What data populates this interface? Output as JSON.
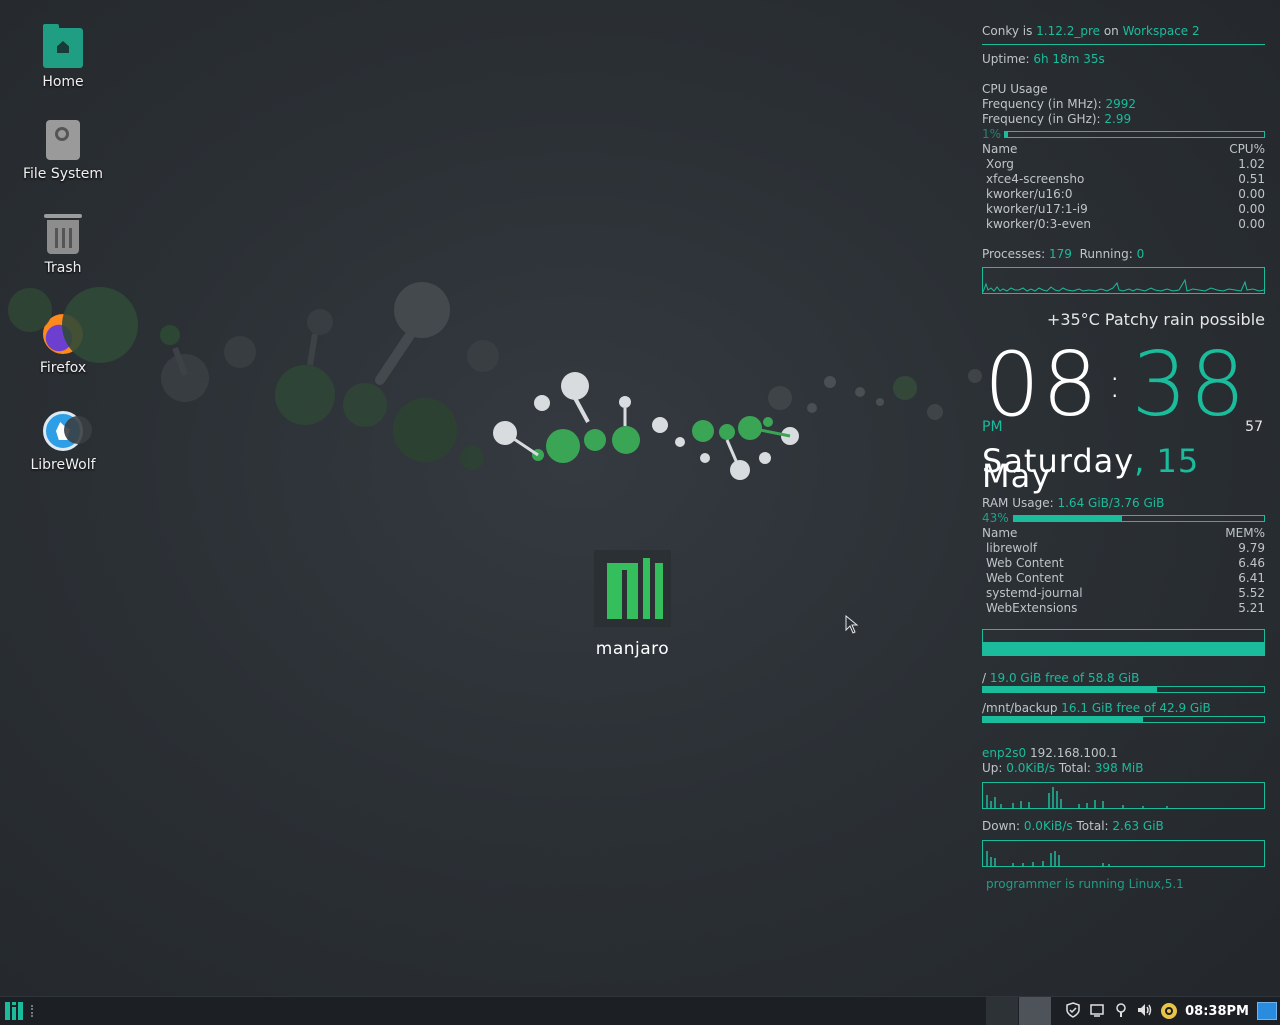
{
  "desktop": {
    "icons": [
      {
        "label": "Home",
        "icon": "home-folder-icon"
      },
      {
        "label": "File System",
        "icon": "drive-icon"
      },
      {
        "label": "Trash",
        "icon": "trash-icon"
      },
      {
        "label": "Firefox",
        "icon": "firefox-icon"
      },
      {
        "label": "LibreWolf",
        "icon": "librewolf-icon"
      }
    ],
    "wallpaper_logo_text": "manjaro"
  },
  "conky": {
    "header": {
      "prefix": "Conky is ",
      "version": "1.12.2_pre",
      "on": " on ",
      "workspace": "Workspace 2"
    },
    "uptime": {
      "label": "Uptime: ",
      "value": "6h 18m 35s"
    },
    "cpu": {
      "title": "CPU Usage",
      "freq_mhz_label": "Frequency (in MHz): ",
      "freq_mhz": "2992",
      "freq_ghz_label": "Frequency (in GHz): ",
      "freq_ghz": "2.99",
      "usage_text": "1%",
      "usage_fraction": 0.01,
      "col_name": "Name",
      "col_value": "CPU%",
      "processes": [
        {
          "name": "Xorg",
          "value": "1.02"
        },
        {
          "name": "xfce4-screensho",
          "value": "0.51"
        },
        {
          "name": "kworker/u16:0",
          "value": "0.00"
        },
        {
          "name": "kworker/u17:1-i9",
          "value": "0.00"
        },
        {
          "name": "kworker/0:3-even",
          "value": "0.00"
        }
      ]
    },
    "procs": {
      "label": "Processes: ",
      "count": "179",
      "running_label": "Running: ",
      "running": "0"
    },
    "weather": "+35°C Patchy rain possible",
    "clock": {
      "hours": "08",
      "sep": ":",
      "minutes": "38",
      "ampm": "PM",
      "seconds": "57"
    },
    "date": {
      "weekday": "Saturday",
      "comma": ",",
      "day": "15",
      "month": "May"
    },
    "ram": {
      "label": "RAM Usage: ",
      "value": "1.64 GiB/3.76 GiB",
      "usage_text": "43%",
      "usage_fraction": 0.43,
      "col_name": "Name",
      "col_value": "MEM%",
      "processes": [
        {
          "name": "librewolf",
          "value": "9.79"
        },
        {
          "name": "Web Content",
          "value": "6.46"
        },
        {
          "name": "Web Content",
          "value": "6.41"
        },
        {
          "name": "systemd-journal",
          "value": "5.52"
        },
        {
          "name": "WebExtensions",
          "value": "5.21"
        }
      ]
    },
    "disks": [
      {
        "mount": "/",
        "info": "19.0 GiB free of 58.8 GiB",
        "used_fraction": 0.62
      },
      {
        "mount": "/mnt/backup",
        "info": "16.1 GiB free of 42.9 GiB",
        "used_fraction": 0.57
      }
    ],
    "network": {
      "iface": "enp2s0",
      "ip": "192.168.100.1",
      "up_label": "Up: ",
      "up_speed": "0.0KiB/s",
      "up_total_label": " Total: ",
      "up_total": "398 MiB",
      "down_label": "Down: ",
      "down_speed": "0.0KiB/s",
      "down_total_label": " Total: ",
      "down_total": "2.63 GiB"
    },
    "footer": "programmer is running Linux,5.1",
    "accent_color": "#1abc9c"
  },
  "taskbar": {
    "clock": "08:38PM",
    "tray_icons": [
      "shield-icon",
      "display-icon",
      "bulb-icon",
      "volume-icon",
      "network-manager-icon"
    ]
  }
}
